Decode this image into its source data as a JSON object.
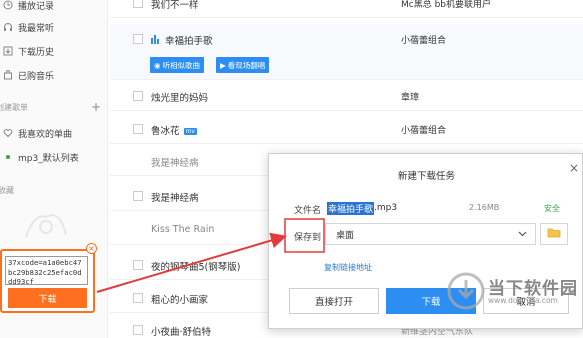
{
  "sidebar": {
    "items": [
      {
        "label": "播放记录",
        "icon": "history-icon"
      },
      {
        "label": "我最常听",
        "icon": "headphone-icon"
      },
      {
        "label": "下载历史",
        "icon": "download-icon"
      },
      {
        "label": "已购音乐",
        "icon": "bag-icon"
      }
    ],
    "created_section": "创建歌单",
    "playlists": [
      {
        "label": "我喜欢的单曲",
        "icon": "heart-icon"
      },
      {
        "label": "mp3_默认列表",
        "icon": "dot-icon"
      }
    ],
    "collected_section": "收藏"
  },
  "mini_box": {
    "text": "37xcode=a1a0ebc47bc29b832c25efac0ddd93cf",
    "download_label": "下载",
    "close_label": "×"
  },
  "songs": [
    {
      "title": "我们不一样",
      "artist": "Mc黑总 bb机要联用户"
    },
    {
      "title": "幸福拍手歌",
      "artist": "小蓓蕾组合"
    },
    {
      "title": "烛光里的妈妈",
      "artist": "章璋"
    },
    {
      "title": "鲁冰花",
      "artist": "小蓓蕾组合",
      "badge": "mv"
    },
    {
      "title": "我是神经病",
      "artist": ""
    },
    {
      "title": "我是神经病",
      "artist": ""
    },
    {
      "title": "Kiss The Rain",
      "artist": ""
    },
    {
      "title": "夜的钢琴曲5(钢琴版)",
      "artist": ""
    },
    {
      "title": "粗心的小画家",
      "artist": ""
    },
    {
      "title": "小夜曲·舒伯特",
      "artist": "新维茎内空气东队"
    }
  ],
  "song_tags": {
    "similar": "听相似歌曲",
    "mv": "看现场翻唱"
  },
  "dialog": {
    "title": "新建下载任务",
    "close": "×",
    "file_label": "文件名",
    "file_name": "幸福拍手歌",
    "file_ext": ".mp3",
    "file_size": "2.16MB",
    "file_safe": "安全",
    "save_label": "保存到",
    "save_value": "桌面",
    "copy_link": "复制链接地址",
    "btn_open": "直接打开",
    "btn_download": "下载",
    "btn_cancel": "取消"
  },
  "watermark": {
    "cn": "当下软件园",
    "en": "www.downxia.com"
  },
  "colors": {
    "accent": "#2b8ef0",
    "orange": "#ff6f20",
    "red": "#e23b3b",
    "safe_green": "#3aa34e"
  }
}
